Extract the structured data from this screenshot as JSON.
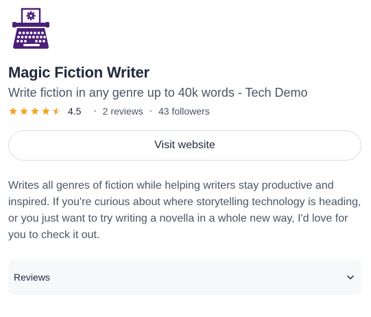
{
  "product": {
    "logo_icon": "typewriter-gear-icon",
    "name": "Magic Fiction Writer",
    "tagline": "Write fiction in any genre up to 40k words - Tech Demo",
    "rating": {
      "stars": 4.5,
      "value_text": "4.5",
      "star_color": "#f5a524"
    },
    "reviews_text": "2 reviews",
    "followers_text": "43 followers",
    "visit_label": "Visit website",
    "description": "Writes all genres of fiction while helping writers stay productive and inspired. If you're curious about where storytelling technology is heading, or you just want to try writing a novella in a whole new way, I'd love for you to check it out."
  },
  "reviews_section": {
    "label": "Reviews",
    "icon": "chevron-down-icon"
  },
  "colors": {
    "brand_purple": "#4b1f7a",
    "text_primary": "#21293c",
    "text_secondary": "#4b5563"
  }
}
